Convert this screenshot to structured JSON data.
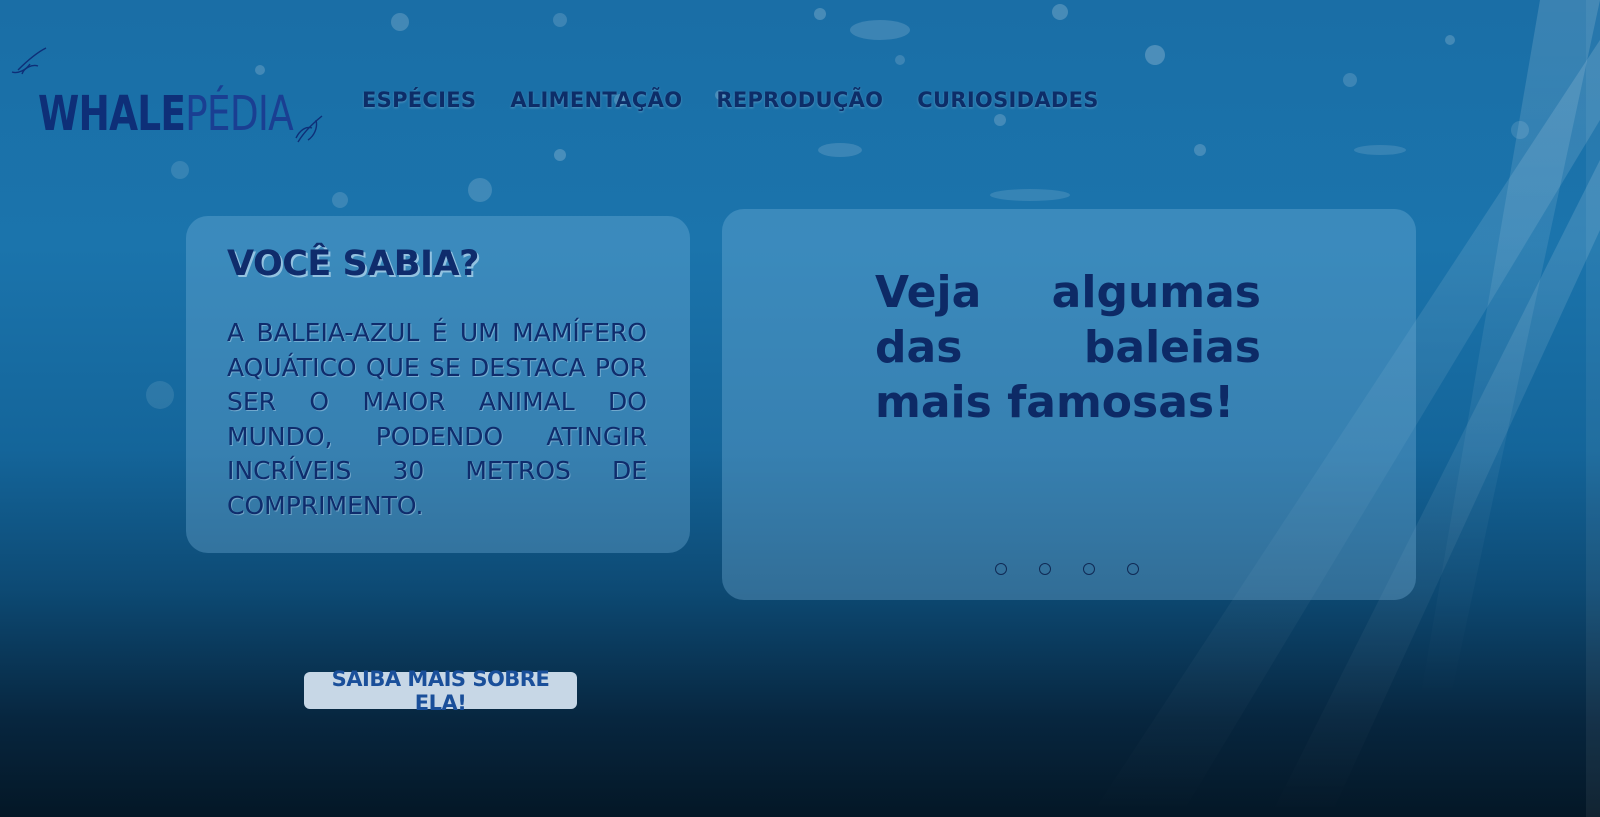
{
  "brand": {
    "name_part1": "WHALE",
    "name_part2": "PÉDIA"
  },
  "nav": {
    "items": [
      "ESPÉCIES",
      "ALIMENTAÇÃO",
      "REPRODUÇÃO",
      "CURIOSIDADES"
    ]
  },
  "fact_card": {
    "title": "VOCÊ SABIA?",
    "body": "A baleia-azul é um mamífero aquático que se destaca por ser o maior animal do mundo, podendo atingir incríveis 30 metros de comprimento."
  },
  "whales_card": {
    "heading": "Veja algumas das baleias mais famosas!",
    "carousel_dots": 4
  },
  "cta": {
    "label": "SAIBA MAIS SOBRE ELA!"
  },
  "colors": {
    "text_dark_blue": "#0f2c6c",
    "cta_background": "#c7d7e6",
    "cta_text": "#1a4f9a"
  }
}
